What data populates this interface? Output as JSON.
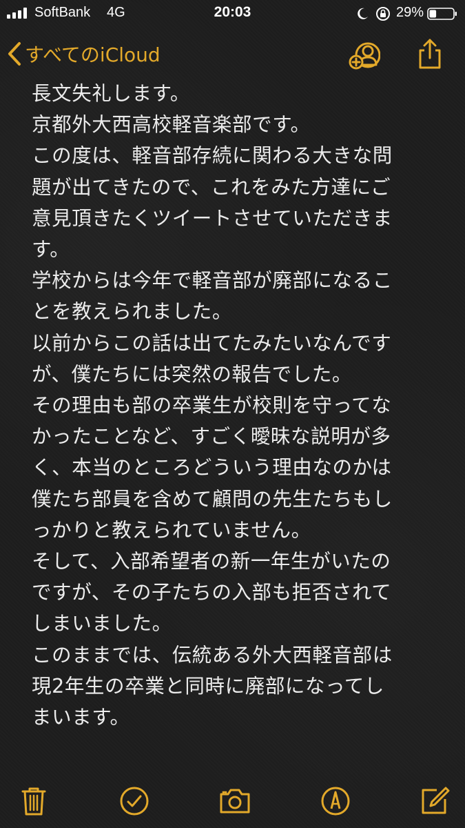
{
  "status_bar": {
    "carrier": "SoftBank",
    "network": "4G",
    "time": "20:03",
    "battery": "29%",
    "battery_level": 0.29
  },
  "nav": {
    "back_label": "すべてのiCloud",
    "collab_icon": "add-person-icon",
    "share_icon": "share-icon"
  },
  "note": {
    "lines": [
      "長文失礼します。",
      "京都外大西高校軽音楽部です。",
      "この度は、軽音部存続に関わる大きな問",
      "題が出てきたので、これをみた方達にご",
      "意見頂きたくツイートさせていただきま",
      "す。",
      "学校からは今年で軽音部が廃部になるこ",
      "とを教えられました。",
      "以前からこの話は出てたみたいなんです",
      "が、僕たちには突然の報告でした。",
      "その理由も部の卒業生が校則を守ってな",
      "かったことなど、すごく曖昧な説明が多",
      "く、本当のところどういう理由なのかは",
      "僕たち部員を含めて顧問の先生たちもし",
      "っかりと教えられていません。",
      "そして、入部希望者の新一年生がいたの",
      "ですが、その子たちの入部も拒否されて",
      "しまいました。",
      "このままでは、伝統ある外大西軽音部は",
      "現2年生の卒業と同時に廃部になってし",
      "まいます。"
    ]
  },
  "toolbar": {
    "items": [
      "trash-icon",
      "checklist-icon",
      "camera-icon",
      "markup-icon",
      "compose-icon"
    ]
  },
  "colors": {
    "accent": "#e3a92a",
    "background": "#1c1c1c",
    "text": "#ececec"
  }
}
